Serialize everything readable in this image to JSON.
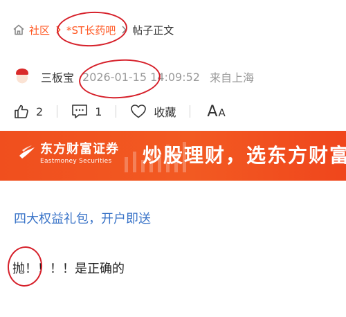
{
  "breadcrumb": {
    "items": [
      "社区",
      "*ST长药吧",
      "帖子正文"
    ]
  },
  "author": {
    "name": "三板宝",
    "time": "2026-01-15 14:09:52",
    "location": "来自上海"
  },
  "actions": {
    "like_count": "2",
    "comment_count": "1",
    "favorite_label": "收藏",
    "font_big": "A",
    "font_small": "A"
  },
  "banner": {
    "brand_cn": "东方财富证券",
    "brand_en": "Eastmoney Securities",
    "slogan": "炒股理财，选东方财富"
  },
  "promo": {
    "text": "四大权益礼包，开户即送"
  },
  "post": {
    "body": "抛！！！！是正确的"
  },
  "colors": {
    "accent": "#ff5722",
    "link": "#3a74c8",
    "banner": "#f25a22",
    "annotation": "#d6202a"
  }
}
